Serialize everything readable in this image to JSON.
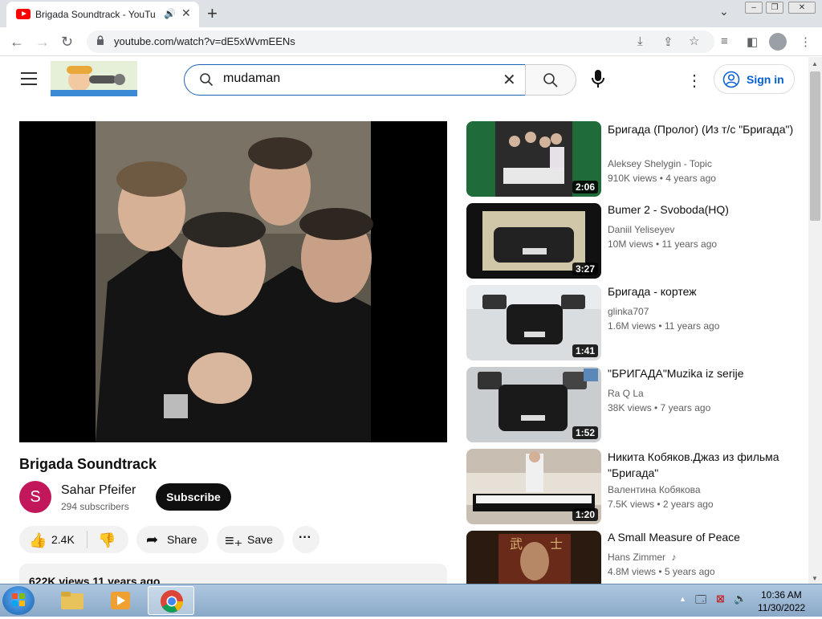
{
  "browser": {
    "tab_title": "Brigada Soundtrack - YouTube",
    "url": "youtube.com/watch?v=dE5xWvmEENs"
  },
  "header": {
    "search_query": "mudaman",
    "signin_label": "Sign in"
  },
  "video": {
    "title": "Brigada Soundtrack",
    "channel": "Sahar Pfeifer",
    "channel_initial": "S",
    "subscribers": "294 subscribers",
    "subscribe_label": "Subscribe",
    "likes": "2.4K",
    "share_label": "Share",
    "save_label": "Save",
    "views_line": "622K views  11 years ago"
  },
  "related": [
    {
      "title": "Бригада (Пролог) (Из т/с \"Бригада\")",
      "channel": "Aleksey Shelygin - Topic",
      "meta": "910K views  • 4 years ago",
      "duration": "2:06"
    },
    {
      "title": "Bumer 2 - Svoboda(HQ)",
      "channel": "Daniil Yeliseyev",
      "meta": "10M views  • 11 years ago",
      "duration": "3:27"
    },
    {
      "title": "Бригада - кортеж",
      "channel": "glinka707",
      "meta": "1.6M views  • 11 years ago",
      "duration": "1:41"
    },
    {
      "title": "\"БРИГАДА\"Muzika iz serije",
      "channel": "Ra Q La",
      "meta": "38K views  • 7 years ago",
      "duration": "1:52"
    },
    {
      "title": "Никита Кобяков.Джаз из фильма \"Бригада\"",
      "channel": "Валентина Кобякова",
      "meta": "7.5K views  • 2 years ago",
      "duration": "1:20"
    },
    {
      "title": "A Small Measure of Peace",
      "channel": "Hans Zimmer",
      "meta": "4.8M views  • 5 years ago",
      "duration": ""
    }
  ],
  "taskbar": {
    "time": "10:36 AM",
    "date": "11/30/2022"
  }
}
